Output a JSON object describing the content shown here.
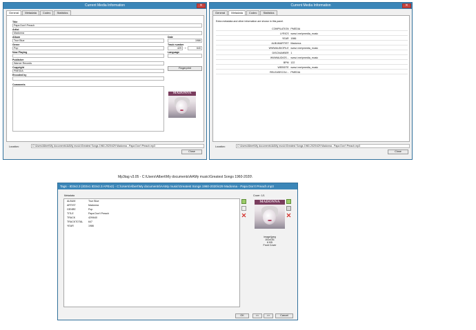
{
  "win1": {
    "title": "Current Media Information",
    "close_glyph": "✕",
    "tabs": [
      "General",
      "Metadata",
      "Codec",
      "Statistics"
    ],
    "title_label": "Title",
    "title_value": "Papa Don't Preach",
    "artist_label": "Artist",
    "artist_value": "Madonna",
    "album_label": "Album",
    "album_value": "True Blue",
    "date_label": "Date",
    "date_value": "1986",
    "genre_label": "Genre",
    "genre_value": "Pop",
    "track_label": "Track number",
    "track_value": "429",
    "track_sep": "/",
    "track_total": "640",
    "now_playing_label": "Now Playing",
    "language_label": "Language",
    "publisher_label": "Publisher",
    "publisher_value": "Warner Records",
    "copyright_label": "Copyright",
    "copyright_value": "PMEDIA",
    "encoded_label": "Encoded by",
    "fingerprint_label": "Fingerprint",
    "comments_label": "Comments",
    "location_label": "Location:",
    "location_value": "C:\\Users\\Albert\\My documents\\AAMy music\\Greatest Songs 1960-2020\\429 Madonna - Papa Don't Preach.mp3",
    "close_label": "Close",
    "cover_text": "MADONNA"
  },
  "win2": {
    "title": "Current Media Information",
    "close_glyph": "✕",
    "tabs": [
      "General",
      "Metadata",
      "Codec",
      "Statistics"
    ],
    "intro": "Extra metadata and other information are shown in this panel.",
    "rows": [
      {
        "k": "COMPILATION",
        "v": "PMEDIA"
      },
      {
        "k": "LYRICS",
        "v": "www.t.me/pmedia_music"
      },
      {
        "k": "YEAR",
        "v": "1986"
      },
      {
        "k": "ALBUMARTIST",
        "v": "Madonna"
      },
      {
        "k": "WWWAUDIOFILE",
        "v": "www.t.me/pmedia_music"
      },
      {
        "k": "DISCNUMBER",
        "v": "1"
      },
      {
        "k": "WWWAUDIOS...",
        "v": "www.t.me/pmedia_music"
      },
      {
        "k": "BPM",
        "v": "122"
      },
      {
        "k": "WEBSITE",
        "v": "www.t.me/pmedia_music"
      },
      {
        "k": "RELEASECOU...",
        "v": "PMEDIA"
      }
    ],
    "location_label": "Location:",
    "location_value": "C:\\Users\\Albert\\My documents\\AAMy music\\Greatest Songs 1960-2020\\429 Madonna - Papa Don't Preach.mp3",
    "close_label": "Close"
  },
  "caption": "Mp3tag v3.05  -  C:\\Users\\Albert\\My documents\\AAMy music\\Greatest Songs 1960-2020\\",
  "win3": {
    "title": "Tags - ID3v2.3 (ID3v1 ID3v2.3 APEv2) - C:\\Users\\Albert\\My documents\\AAMy music\\Greatest Songs 1960-2020\\429 Madonna - Papa Don't Preach.mp3",
    "metadata_label": "Metadata",
    "rows": [
      {
        "k": "ALBUM",
        "v": "True Blue"
      },
      {
        "k": "ARTIST",
        "v": "Madonna"
      },
      {
        "k": "GENRE",
        "v": "Pop"
      },
      {
        "k": "TITLE",
        "v": "Papa Don't Preach"
      },
      {
        "k": "TRACK",
        "v": "429/640"
      },
      {
        "k": "TRACKTOTAL",
        "v": "647"
      },
      {
        "k": "YEAR",
        "v": "1986"
      }
    ],
    "cover_label": "Cover: 1/1",
    "cover_text": "MADONNA",
    "img_type": "image/jpeg",
    "img_dims": "151x151",
    "img_size": "6 KB",
    "img_kind": "Front Cover",
    "ok_label": "OK",
    "prev_label": "<<",
    "next_label": ">>",
    "cancel_label": "Cancel"
  }
}
